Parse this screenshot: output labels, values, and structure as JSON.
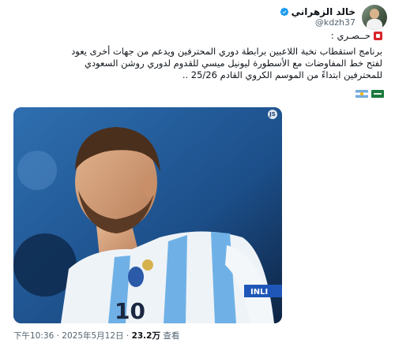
{
  "author": {
    "display_name": "خالد الزهراني",
    "handle": "@kdzh37",
    "verified": true,
    "avatar_icon": "avatar-photo"
  },
  "tweet": {
    "label": "حــصـري :",
    "lines": [
      "برنامج استقطاب نخبة اللاعبين برابطة دوري المحترفين ويدعم من جهات أخرى يعود",
      "لفتح خط المفاوضات مع الأسطورة ليونيل ميسي للقدوم لدوري روشن السعودي",
      "للمحترفين ابتداءً من الموسم الكروي القادم 25/26 .."
    ],
    "flags": [
      "saudi-flag",
      "argentina-flag"
    ]
  },
  "media": {
    "jersey_number": "10",
    "armband_text": "INLI",
    "badge": "JS"
  },
  "meta": {
    "time": "下午10:36",
    "separator": " · ",
    "date": "2025年5月12日",
    "views_count": "23.2万",
    "views_label": "查看"
  },
  "colors": {
    "accent": "#1d9bf0",
    "text": "#0f1419",
    "muted": "#536471"
  }
}
